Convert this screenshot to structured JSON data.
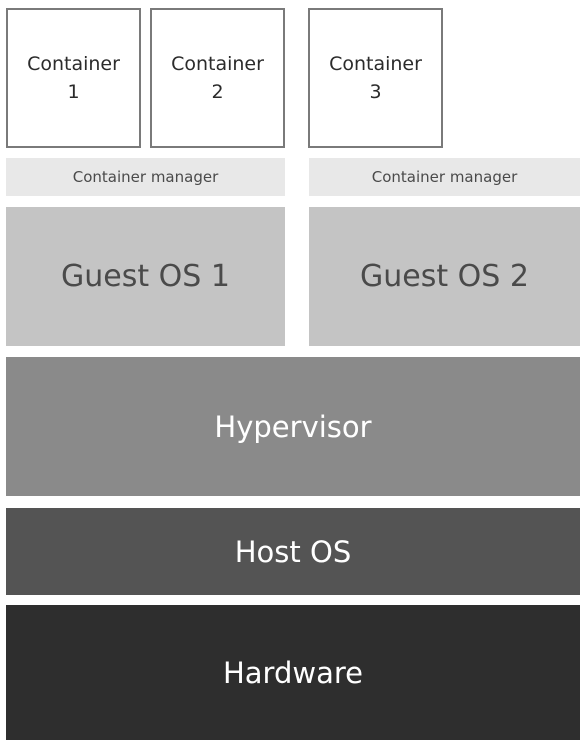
{
  "diagram": {
    "containers": [
      {
        "line1": "Container",
        "line2": "1"
      },
      {
        "line1": "Container",
        "line2": "2"
      },
      {
        "line1": "Container",
        "line2": "3"
      }
    ],
    "container_managers": [
      "Container manager",
      "Container manager"
    ],
    "guest_os": [
      "Guest OS 1",
      "Guest OS 2"
    ],
    "hypervisor": "Hypervisor",
    "host_os": "Host OS",
    "hardware": "Hardware"
  },
  "colors": {
    "container_border": "#7a7a7a",
    "container_manager": "#e8e8e8",
    "guest_os": "#c4c4c4",
    "hypervisor": "#8a8a8a",
    "host_os": "#545454",
    "hardware": "#2e2e2e"
  }
}
